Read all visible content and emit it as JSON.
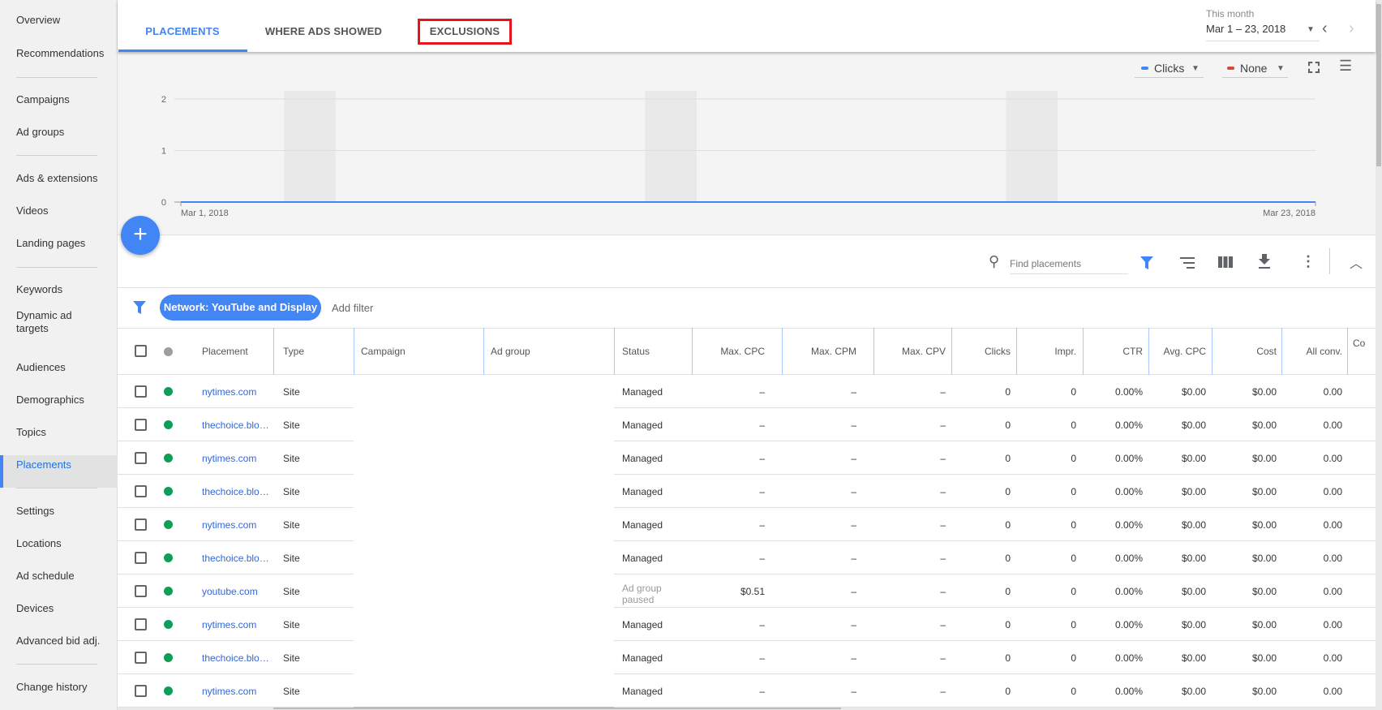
{
  "sidebar": {
    "items": [
      "Overview",
      "Recommendations",
      "Campaigns",
      "Ad groups",
      "Ads & extensions",
      "Videos",
      "Landing pages",
      "Keywords",
      "Dynamic ad targets",
      "Audiences",
      "Demographics",
      "Topics",
      "Placements",
      "Settings",
      "Locations",
      "Ad schedule",
      "Devices",
      "Advanced bid adj.",
      "Change history"
    ],
    "active": "Placements"
  },
  "tabs": [
    "PLACEMENTS",
    "WHERE ADS SHOWED",
    "EXCLUSIONS"
  ],
  "date": {
    "label": "This month",
    "range": "Mar 1 – 23, 2018"
  },
  "metrics": {
    "primary": "Clicks",
    "secondary": "None",
    "primary_color": "#4285f4",
    "secondary_color": "#db4437"
  },
  "chart_data": {
    "type": "line",
    "series": [
      {
        "name": "Clicks",
        "x": [
          "Mar 1",
          "Mar 23"
        ],
        "values": [
          0,
          0
        ]
      }
    ],
    "yticks": [
      "2",
      "1",
      "0"
    ],
    "ylim": [
      0,
      2
    ],
    "xlabels": [
      "Mar 1, 2018",
      "Mar 23, 2018"
    ],
    "weekend_bands_day_index": [
      2,
      9,
      16
    ]
  },
  "toolbar": {
    "search_placeholder": "Find placements"
  },
  "filter": {
    "chip": "Network: YouTube and Display",
    "add": "Add filter"
  },
  "table": {
    "headers": [
      "Placement",
      "Type",
      "Campaign",
      "Ad group",
      "Status",
      "Max. CPC",
      "Max. CPM",
      "Max. CPV",
      "Clicks",
      "Impr.",
      "CTR",
      "Avg. CPC",
      "Cost",
      "All conv.",
      "Co"
    ],
    "rows": [
      [
        "nytimes.com",
        "Site",
        "",
        "",
        "Managed",
        "–",
        "–",
        "–",
        "0",
        "0",
        "0.00%",
        "$0.00",
        "$0.00",
        "0.00"
      ],
      [
        "thechoice.blo…",
        "Site",
        "",
        "",
        "Managed",
        "–",
        "–",
        "–",
        "0",
        "0",
        "0.00%",
        "$0.00",
        "$0.00",
        "0.00"
      ],
      [
        "nytimes.com",
        "Site",
        "",
        "",
        "Managed",
        "–",
        "–",
        "–",
        "0",
        "0",
        "0.00%",
        "$0.00",
        "$0.00",
        "0.00"
      ],
      [
        "thechoice.blo…",
        "Site",
        "",
        "",
        "Managed",
        "–",
        "–",
        "–",
        "0",
        "0",
        "0.00%",
        "$0.00",
        "$0.00",
        "0.00"
      ],
      [
        "nytimes.com",
        "Site",
        "",
        "",
        "Managed",
        "–",
        "–",
        "–",
        "0",
        "0",
        "0.00%",
        "$0.00",
        "$0.00",
        "0.00"
      ],
      [
        "thechoice.blo…",
        "Site",
        "",
        "",
        "Managed",
        "–",
        "–",
        "–",
        "0",
        "0",
        "0.00%",
        "$0.00",
        "$0.00",
        "0.00"
      ],
      [
        "youtube.com",
        "Site",
        "",
        "",
        "Ad group paused",
        "$0.51",
        "–",
        "–",
        "0",
        "0",
        "0.00%",
        "$0.00",
        "$0.00",
        "0.00"
      ],
      [
        "nytimes.com",
        "Site",
        "",
        "",
        "Managed",
        "–",
        "–",
        "–",
        "0",
        "0",
        "0.00%",
        "$0.00",
        "$0.00",
        "0.00"
      ],
      [
        "thechoice.blo…",
        "Site",
        "",
        "",
        "Managed",
        "–",
        "–",
        "–",
        "0",
        "0",
        "0.00%",
        "$0.00",
        "$0.00",
        "0.00"
      ],
      [
        "nytimes.com",
        "Site",
        "",
        "",
        "Managed",
        "–",
        "–",
        "–",
        "0",
        "0",
        "0.00%",
        "$0.00",
        "$0.00",
        "0.00"
      ]
    ]
  }
}
